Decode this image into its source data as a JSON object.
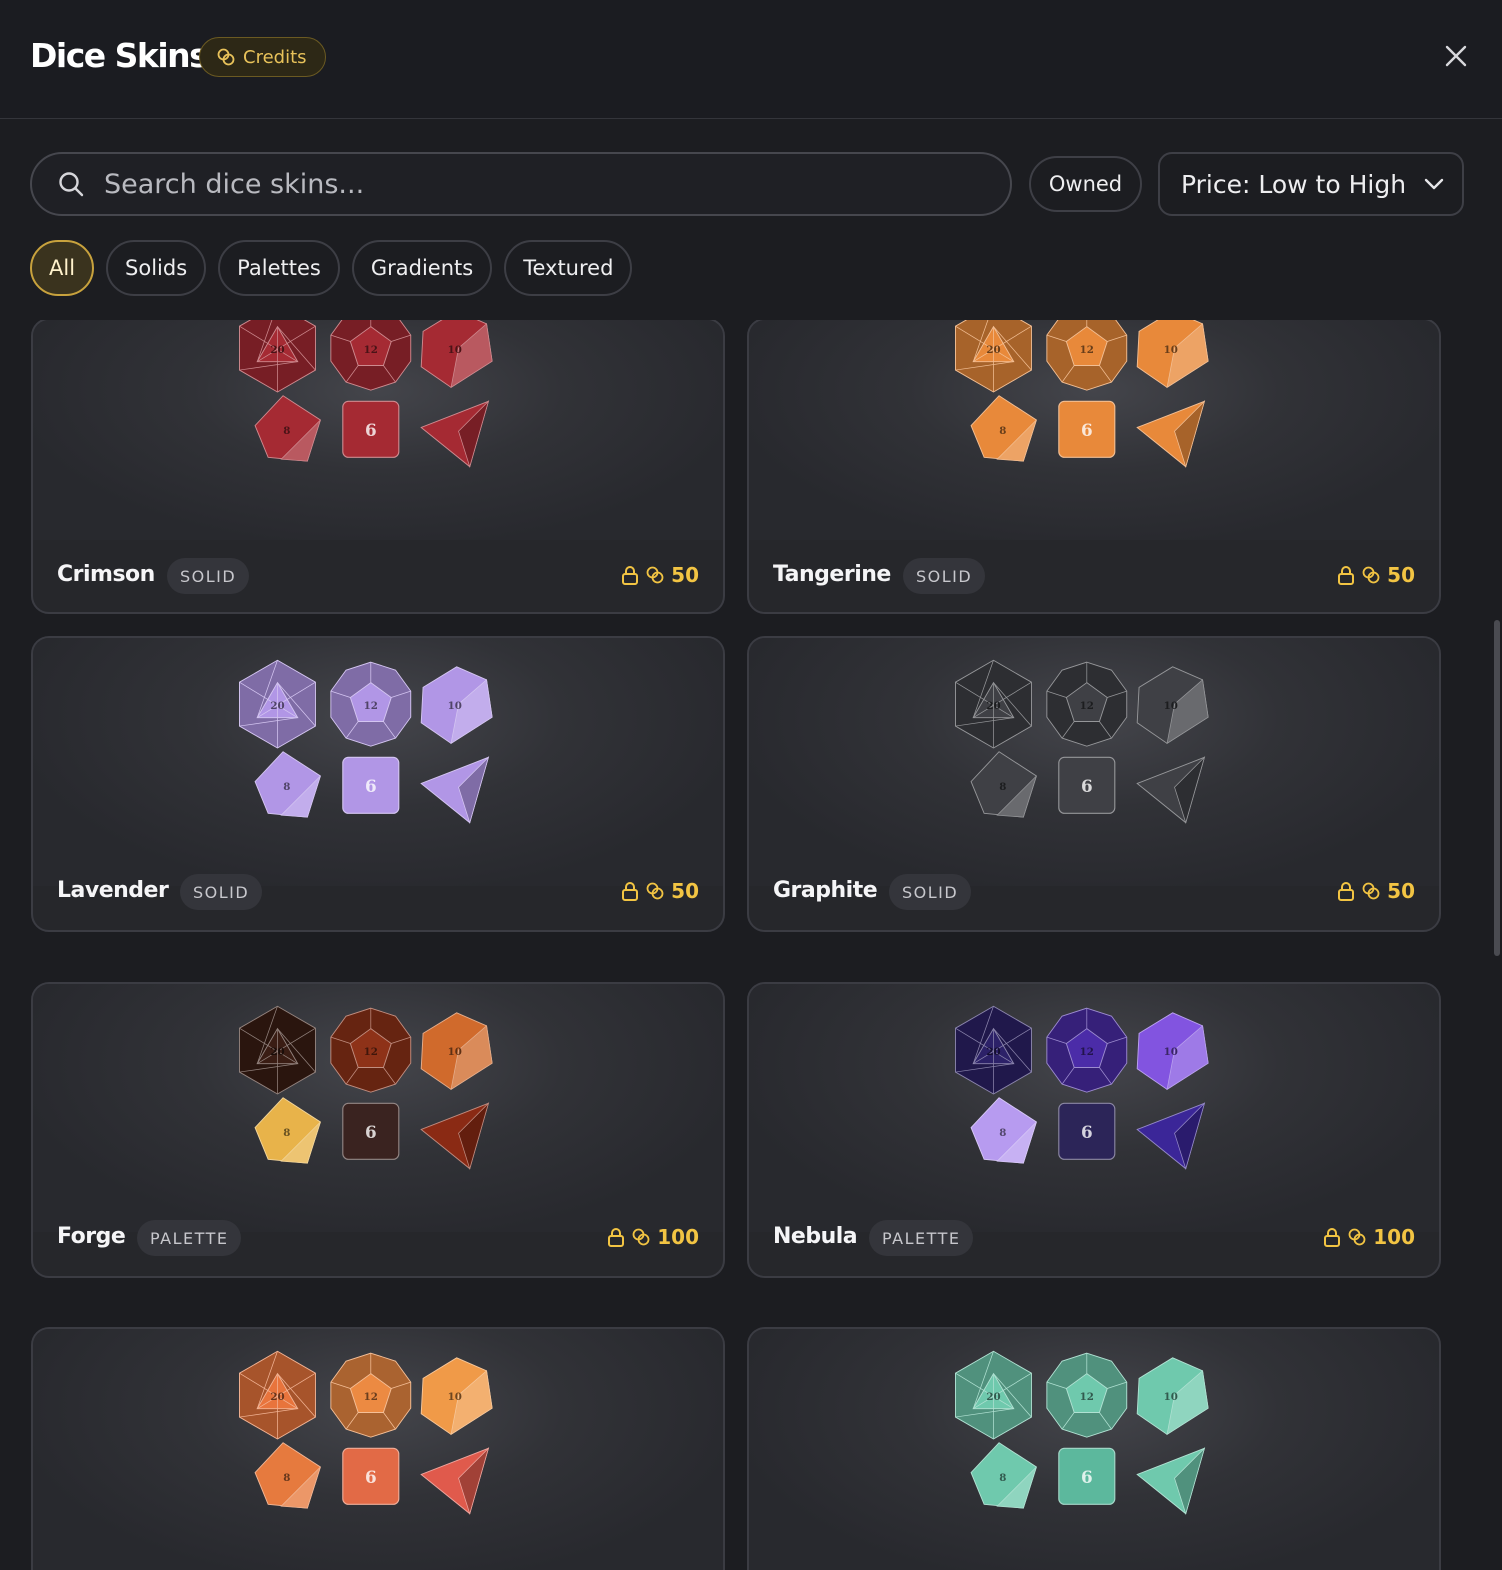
{
  "header": {
    "title": "Dice Skins",
    "credits_label": "Credits"
  },
  "search": {
    "placeholder": "Search dice skins..."
  },
  "filters": {
    "owned_label": "Owned",
    "sort_label": "Price: Low to High"
  },
  "categories": [
    "All",
    "Solids",
    "Palettes",
    "Gradients",
    "Textured"
  ],
  "active_category": "All",
  "die_labels": {
    "d20": "20",
    "d12": "12",
    "d10": "10",
    "d8": "8",
    "d6": "6"
  },
  "skins": [
    {
      "name": "Crimson",
      "category": "SOLID",
      "price": "50",
      "colors": [
        "#a52a33",
        "#a52a33",
        "#a52a33",
        "#a52a33",
        "#a52a33",
        "#a52a33"
      ]
    },
    {
      "name": "Tangerine",
      "category": "SOLID",
      "price": "50",
      "colors": [
        "#e8893a",
        "#e8893a",
        "#e8893a",
        "#e8893a",
        "#e8893a",
        "#e8893a"
      ]
    },
    {
      "name": "Lavender",
      "category": "SOLID",
      "price": "50",
      "colors": [
        "#b196e6",
        "#b196e6",
        "#b196e6",
        "#b196e6",
        "#b196e6",
        "#b196e6"
      ]
    },
    {
      "name": "Graphite",
      "category": "SOLID",
      "price": "50",
      "colors": [
        "#3f4045",
        "#3f4045",
        "#3f4045",
        "#3f4045",
        "#3f4045",
        "#3f4045"
      ]
    },
    {
      "name": "Forge",
      "category": "PALETTE",
      "price": "100",
      "colors": [
        "#3a1d14",
        "#8e3218",
        "#d06a2c",
        "#e8b34a",
        "#3a2320",
        "#8a2a14"
      ]
    },
    {
      "name": "Nebula",
      "category": "PALETTE",
      "price": "100",
      "colors": [
        "#2c2168",
        "#4b2ca8",
        "#8254e0",
        "#b79bf0",
        "#2c2558",
        "#3b2698"
      ]
    },
    {
      "name": "",
      "category": "",
      "price": "",
      "colors": [
        "#e8743c",
        "#ec8a42",
        "#f09a48",
        "#e67a3e",
        "#e26a46",
        "#e05a4c"
      ]
    },
    {
      "name": "",
      "category": "",
      "price": "",
      "colors": [
        "#6fc9ad",
        "#6fc9ad",
        "#6fc9ad",
        "#6fc9ad",
        "#5cb89d",
        "#6fc9ad"
      ]
    }
  ]
}
